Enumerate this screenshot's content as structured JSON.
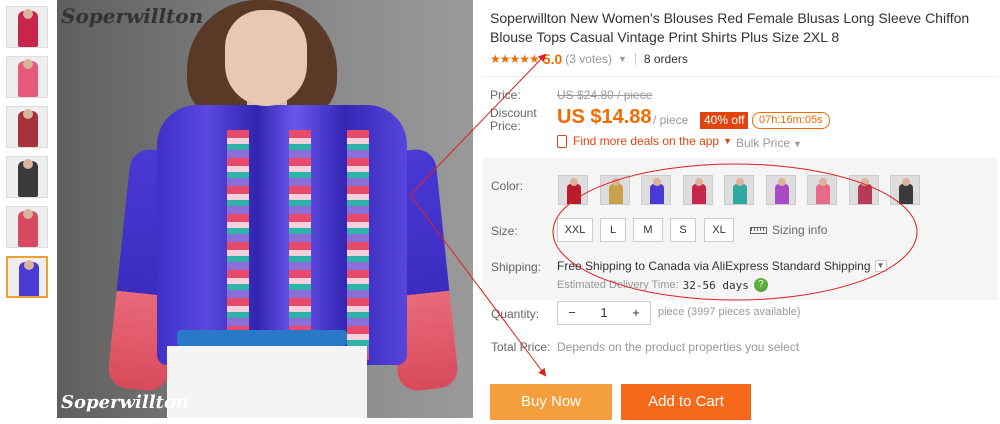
{
  "brand_watermark": "Soperwillton",
  "thumbnails": [
    {
      "color": "#c8254a"
    },
    {
      "color": "#e85a7a"
    },
    {
      "color": "#a8323a"
    },
    {
      "color": "#3a3a3a"
    },
    {
      "color": "#d84a62"
    },
    {
      "color": "#4a3ad4"
    }
  ],
  "product": {
    "title": "Soperwillton New Women's Blouses Red Female Blusas Long Sleeve Chiffon Blouse Tops Casual Vintage Print Shirts Plus Size 2XL 8",
    "stars": "★★★★★",
    "score": "5.0",
    "votes": "(3 votes)",
    "orders": "8 orders"
  },
  "price": {
    "label": "Price:",
    "original": "US $24.80 / piece",
    "discount_label": "Discount Price:",
    "discount": "US $14.88",
    "per_piece": "/ piece",
    "off_badge": "40% off",
    "timer": "07h:16m:05s",
    "app_deals": "Find more deals on the app",
    "bulk": "Bulk Price"
  },
  "options": {
    "color_label": "Color:",
    "swatches": [
      "#b81c2c",
      "#c9a04a",
      "#4a3ad4",
      "#c8254a",
      "#2fa8a0",
      "#a84ac8",
      "#e86a8a",
      "#b83a5a",
      "#3a3a3a"
    ],
    "size_label": "Size:",
    "sizes": [
      "XXL",
      "L",
      "M",
      "S",
      "XL"
    ],
    "sizing_info": "Sizing info"
  },
  "shipping": {
    "label": "Shipping:",
    "text": "Free Shipping to Canada via AliExpress Standard Shipping",
    "delivery_label": "Estimated Delivery Time:",
    "delivery_days": "32-56 days"
  },
  "quantity": {
    "label": "Quantity:",
    "minus": "−",
    "value": "1",
    "plus": "+",
    "note": "piece (3997 pieces available)"
  },
  "total": {
    "label": "Total Price:",
    "note": "Depends on the product properties you select"
  },
  "buttons": {
    "buy_now": "Buy Now",
    "add_to_cart": "Add to Cart"
  },
  "colors": {
    "accent": "#f56a00",
    "badge": "#e0450e",
    "annotation": "#e02020"
  }
}
